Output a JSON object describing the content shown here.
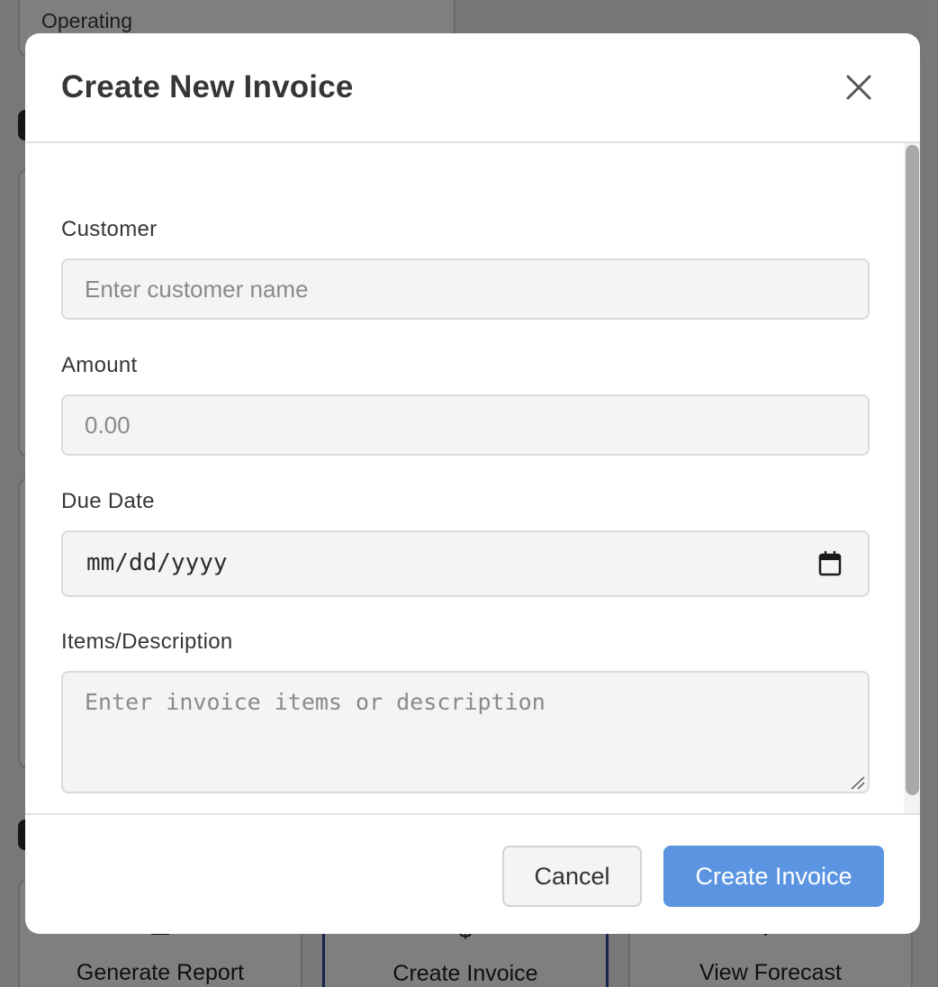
{
  "background": {
    "status_text": "Operating",
    "quick_actions": [
      {
        "label": "Generate Report",
        "icon": "report-icon"
      },
      {
        "label": "Create Invoice",
        "icon": "dollar-icon"
      },
      {
        "label": "View Forecast",
        "icon": "forecast-icon"
      }
    ]
  },
  "modal": {
    "title": "Create New Invoice",
    "close_icon": "close-icon",
    "fields": {
      "customer": {
        "label": "Customer",
        "placeholder": "Enter customer name",
        "value": ""
      },
      "amount": {
        "label": "Amount",
        "placeholder": "0.00",
        "value": ""
      },
      "due_date": {
        "label": "Due Date",
        "placeholder": "mm/dd/yyyy",
        "icon": "calendar-icon"
      },
      "items": {
        "label": "Items/Description",
        "placeholder": "Enter invoice items or description",
        "value": ""
      }
    },
    "footer": {
      "cancel_label": "Cancel",
      "submit_label": "Create Invoice"
    }
  },
  "colors": {
    "primary_button": "#5b94e0",
    "overlay": "rgba(0,0,0,0.5)"
  }
}
